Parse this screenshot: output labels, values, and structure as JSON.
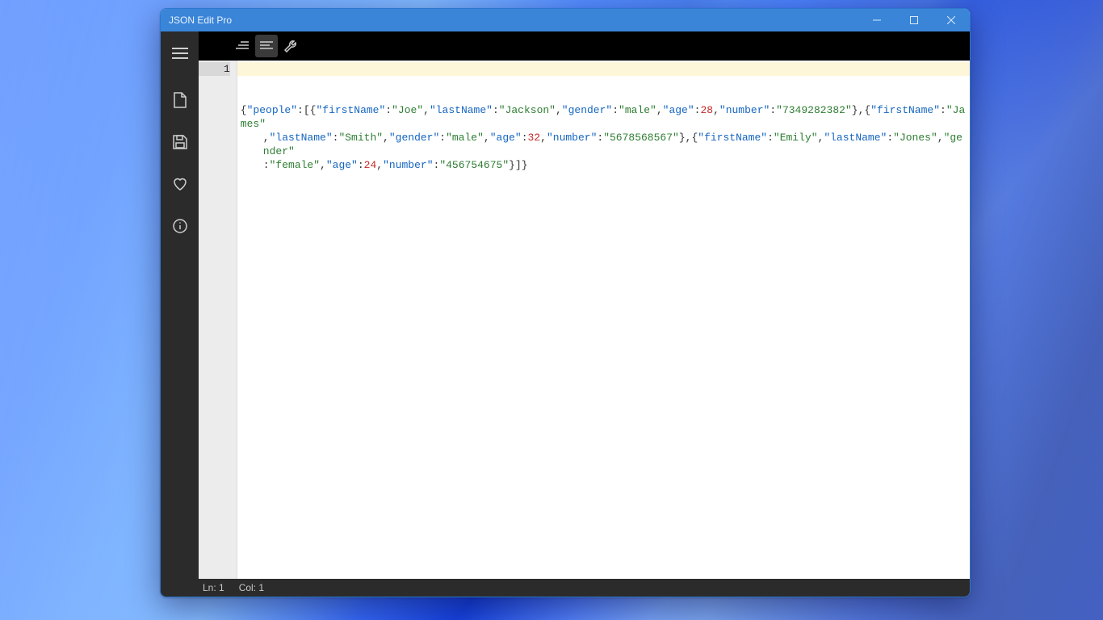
{
  "window": {
    "title": "JSON Edit Pro"
  },
  "sidebar": {
    "items": [
      {
        "name": "hamburger-menu-icon"
      },
      {
        "name": "new-file-icon"
      },
      {
        "name": "save-icon"
      },
      {
        "name": "favorite-icon"
      },
      {
        "name": "info-icon"
      }
    ]
  },
  "toolbar": {
    "items": [
      {
        "name": "indent-right-icon",
        "active": false
      },
      {
        "name": "align-left-icon",
        "active": true
      },
      {
        "name": "wrench-icon",
        "active": false
      }
    ]
  },
  "editor": {
    "line_number": "1",
    "json_content": {
      "people": [
        {
          "firstName": "Joe",
          "lastName": "Jackson",
          "gender": "male",
          "age": 28,
          "number": "7349282382"
        },
        {
          "firstName": "James",
          "lastName": "Smith",
          "gender": "male",
          "age": 32,
          "number": "5678568567"
        },
        {
          "firstName": "Emily",
          "lastName": "Jones",
          "gender": "female",
          "age": 24,
          "number": "456754675"
        }
      ]
    }
  },
  "status": {
    "line_label": "Ln: 1",
    "col_label": "Col: 1"
  }
}
